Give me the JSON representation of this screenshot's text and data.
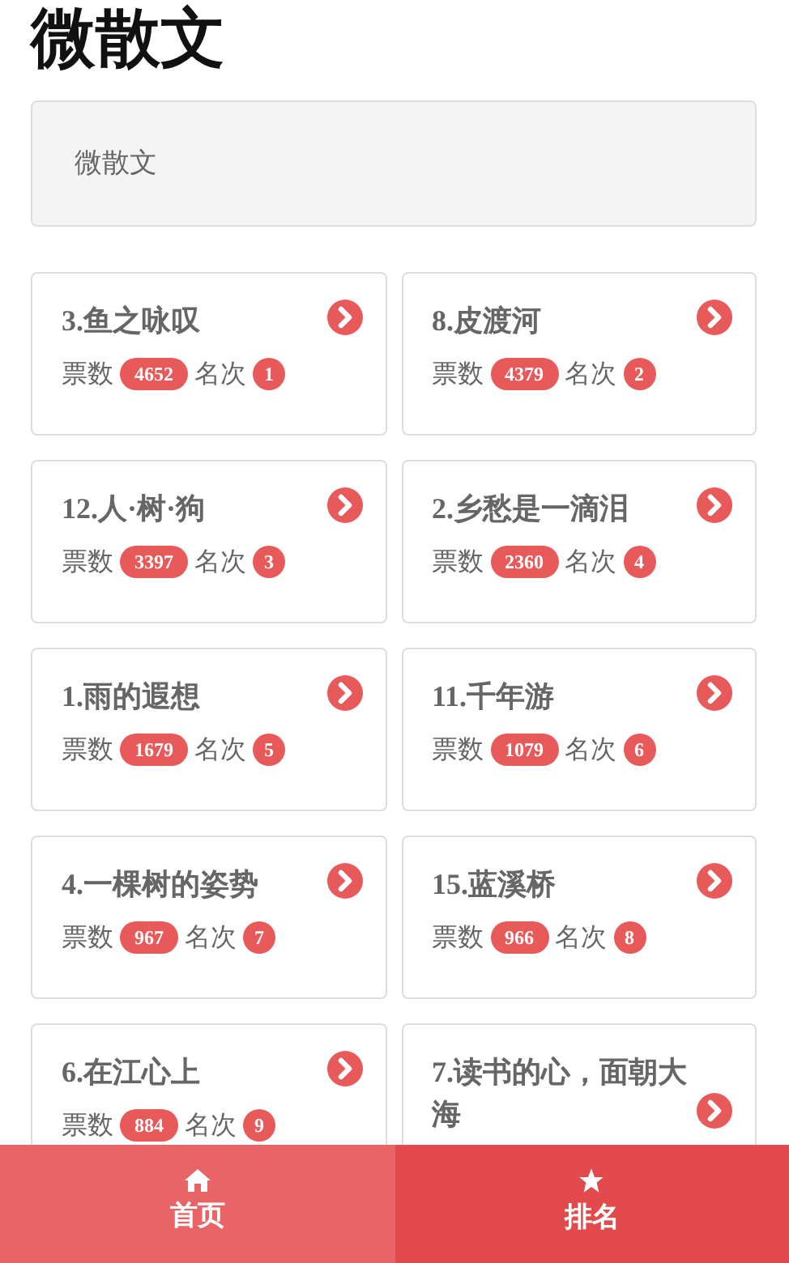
{
  "page_title": "微散文",
  "search": {
    "placeholder": "微散文"
  },
  "entries": [
    {
      "title": "3.鱼之咏叹",
      "votes_label": "票数",
      "votes": "4652",
      "rank_label": "名次",
      "rank": "1"
    },
    {
      "title": "8.皮渡河",
      "votes_label": "票数",
      "votes": "4379",
      "rank_label": "名次",
      "rank": "2"
    },
    {
      "title": "12.人·树·狗",
      "votes_label": "票数",
      "votes": "3397",
      "rank_label": "名次",
      "rank": "3"
    },
    {
      "title": "2.乡愁是一滴泪",
      "votes_label": "票数",
      "votes": "2360",
      "rank_label": "名次",
      "rank": "4"
    },
    {
      "title": "1.雨的遐想",
      "votes_label": "票数",
      "votes": "1679",
      "rank_label": "名次",
      "rank": "5"
    },
    {
      "title": "11.千年游",
      "votes_label": "票数",
      "votes": "1079",
      "rank_label": "名次",
      "rank": "6"
    },
    {
      "title": "4.一棵树的姿势",
      "votes_label": "票数",
      "votes": "967",
      "rank_label": "名次",
      "rank": "7"
    },
    {
      "title": "15.蓝溪桥",
      "votes_label": "票数",
      "votes": "966",
      "rank_label": "名次",
      "rank": "8"
    },
    {
      "title": "6.在江心上",
      "votes_label": "票数",
      "votes": "884",
      "rank_label": "名次",
      "rank": "9"
    },
    {
      "title": "7.读书的心，面朝大海"
    }
  ],
  "bottom_nav": [
    {
      "label": "首页",
      "kind": "home",
      "selected": false
    },
    {
      "label": "排名",
      "kind": "ranking",
      "selected": true
    }
  ]
}
